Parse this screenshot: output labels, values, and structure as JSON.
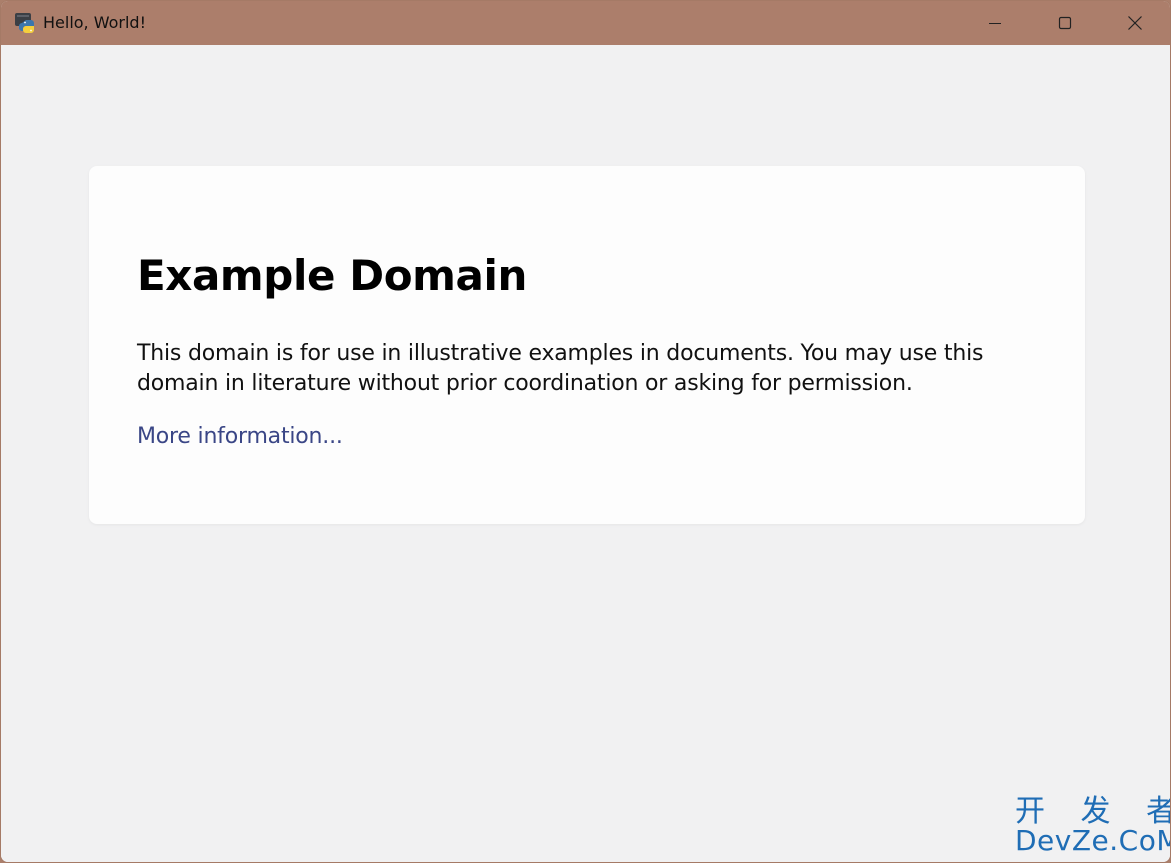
{
  "window": {
    "title": "Hello, World!",
    "icon": "python-icon",
    "controls": {
      "minimize": "minimize-icon",
      "maximize": "maximize-icon",
      "close": "close-icon"
    }
  },
  "page": {
    "heading": "Example Domain",
    "paragraph": "This domain is for use in illustrative examples in documents. You may use this domain in literature without prior coordination or asking for permission.",
    "link_text": "More information..."
  },
  "watermark": {
    "line1": "开 发 者",
    "line2": "DevZe.CoM"
  },
  "colors": {
    "titlebar": "#ac7e6b",
    "content_bg": "#f1f1f2",
    "card_bg": "#fdfdfd",
    "link": "#3a4686",
    "watermark": "#1f6db5"
  }
}
